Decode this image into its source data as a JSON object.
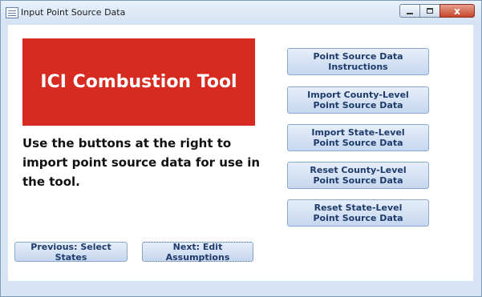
{
  "window": {
    "title": "Input Point Source Data",
    "close_symbol": "x"
  },
  "banner": {
    "text": "ICI Combustion Tool",
    "background": "#d72a20"
  },
  "instruction_text": "Use the buttons at the right to import point source data for use in the tool.",
  "action_buttons": [
    {
      "line1": "Point Source Data",
      "line2": "Instructions"
    },
    {
      "line1": "Import County-Level",
      "line2": "Point Source Data"
    },
    {
      "line1": "Import State-Level",
      "line2": "Point Source Data"
    },
    {
      "line1": "Reset County-Level",
      "line2": "Point Source Data"
    },
    {
      "line1": "Reset State-Level",
      "line2": "Point Source Data"
    }
  ],
  "nav": {
    "previous_label": "Previous: Select States",
    "next_label": "Next: Edit Assumptions"
  }
}
